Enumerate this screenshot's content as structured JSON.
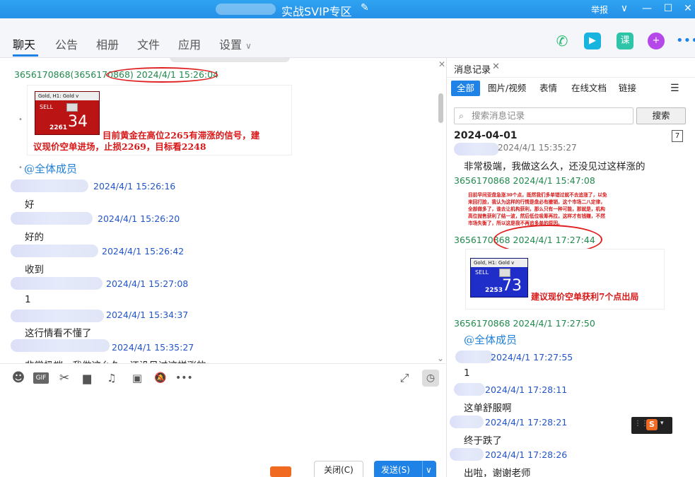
{
  "window": {
    "title": "实战SVIP专区",
    "report_label": "举报",
    "controls": [
      "∨",
      "—",
      "☐",
      "✕"
    ]
  },
  "tabs": [
    {
      "label": "聊天",
      "active": true
    },
    {
      "label": "公告"
    },
    {
      "label": "相册"
    },
    {
      "label": "文件"
    },
    {
      "label": "应用"
    },
    {
      "label": "设置"
    }
  ],
  "toolbar_icons": [
    "phone-icon",
    "video-icon",
    "course-icon",
    "add-icon",
    "more-icon"
  ],
  "course_label": "课",
  "chat": {
    "messages": [
      {
        "sender": "3656170868(3656170868)",
        "time": "2024/4/1 15:26:04"
      },
      {
        "sender_hidden": true,
        "time": "2024/4/1 15:26:16",
        "text": "好"
      },
      {
        "sender_hidden": true,
        "time": "2024/4/1 15:26:20",
        "text": "好的"
      },
      {
        "sender_hidden": true,
        "time": "2024/4/1 15:26:42",
        "text": "收到"
      },
      {
        "sender_hidden": true,
        "time": "2024/4/1 15:27:08",
        "text": "1"
      },
      {
        "sender_hidden": true,
        "time": "2024/4/1 15:34:37",
        "text": "这行情看不懂了"
      },
      {
        "sender_hidden": true,
        "time": "2024/4/1 15:35:27",
        "text": "非常极端，我做这么久，还没见过这样涨的"
      }
    ],
    "trade_image": {
      "header": "Gold, H1: Gold v",
      "side": "SELL",
      "price_small": "2261",
      "price_big": "34",
      "caption_line1": "目前黄金在高位2265有滞涨的信号，建",
      "caption_line2": "议现价空单进场，止损2269，目标看2248"
    },
    "mention": "@全体成员"
  },
  "input": {
    "icons": [
      "emoji-icon",
      "gif-icon",
      "scissors-icon",
      "folder-icon",
      "music-icon",
      "image-icon",
      "mute-icon",
      "more-icon"
    ],
    "gif_label": "GIF",
    "close_label": "关闭(C)",
    "send_label": "发送(S)"
  },
  "history": {
    "title": "消息记录",
    "filters": [
      "全部",
      "图片/视频",
      "表情",
      "在线文档",
      "链接"
    ],
    "search_placeholder": "搜索消息记录",
    "search_button": "搜索",
    "date": "2024-04-01",
    "calendar_day": "7",
    "items": [
      {
        "time": "2024/4/1 15:35:27",
        "text": "非常极端，我做这么久，还没见过这样涨的"
      },
      {
        "sender": "3656170868",
        "time": "2024/4/1 15:47:08"
      },
      {
        "sender": "3656170868",
        "time": "2024/4/1 17:27:44"
      },
      {
        "sender": "3656170868",
        "time": "2024/4/1 17:27:50"
      },
      {
        "time": "2024/4/1 17:27:55",
        "text": "1"
      },
      {
        "time": "2024/4/1 17:28:11",
        "text": "这单舒服啊"
      },
      {
        "time": "2024/4/1 17:28:21",
        "text": "终于跌了"
      },
      {
        "time": "2024/4/1 17:28:26",
        "text": "出啦，谢谢老师"
      }
    ],
    "long_text": [
      "目前早间亚盘急涨30个点，既然我们多单错过就不去追涨了，以免",
      "来回打脸，我认为这样的行情是盘必有撤销，这个市场二八定律，",
      "全部做多了，谁去让机构获利，那么只有一种可能，那就是，机构",
      "高位抛售获利了结一波，然后低位吸筹再拉，这样才有钱赚，不然",
      "市场失衡了，所以这是我不再追多单的原因。"
    ],
    "trade_image": {
      "header": "Gold, H1: Gold v",
      "side": "SELL",
      "price_small": "2253",
      "price_big": "73",
      "caption": "建议现价空单获利7个点出局"
    },
    "mention": "@全体成员"
  }
}
